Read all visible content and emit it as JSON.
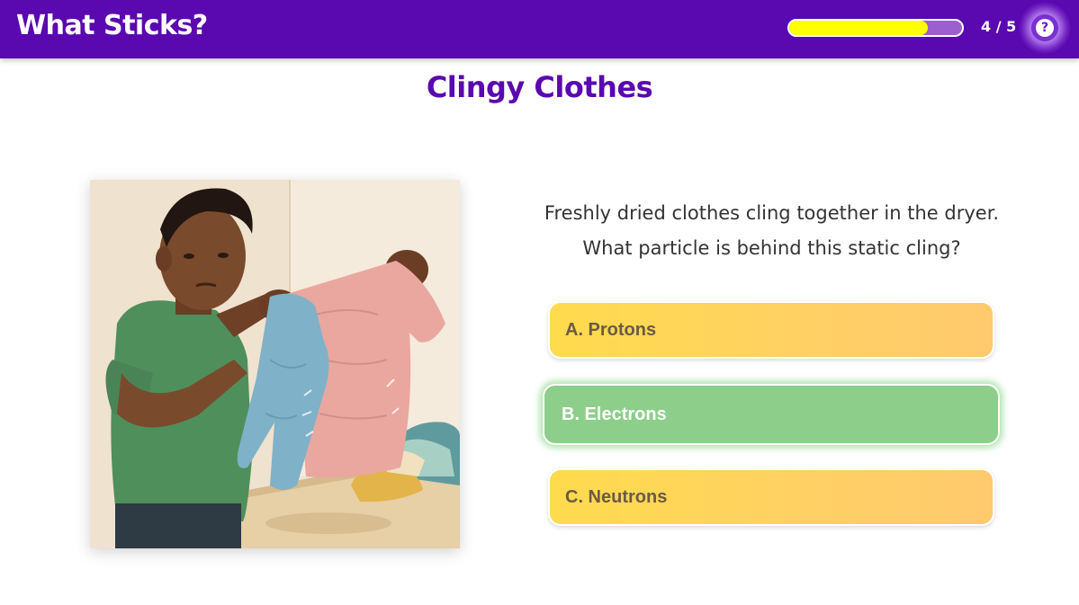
{
  "header": {
    "app_title": "What Sticks?",
    "progress": {
      "current": 4,
      "total": 5,
      "label": "4 / 5",
      "fill_fraction": 0.8
    },
    "help_icon": "question-circle-icon",
    "colors": {
      "bar": "#5a08b0",
      "progress_fill": "#ffff00"
    }
  },
  "main": {
    "title": "Clingy Clothes",
    "question_lines": [
      "Freshly dried clothes cling together in the dryer.",
      "What particle is behind this static cling?"
    ],
    "options": [
      {
        "label": "A.  Protons",
        "state": "default"
      },
      {
        "label": "B.  Electrons",
        "state": "selected"
      },
      {
        "label": "C.  Neutrons",
        "state": "default"
      }
    ],
    "colors": {
      "title": "#5a08b0",
      "option_default": "#ffd65c",
      "option_selected": "#8dce8b"
    }
  }
}
